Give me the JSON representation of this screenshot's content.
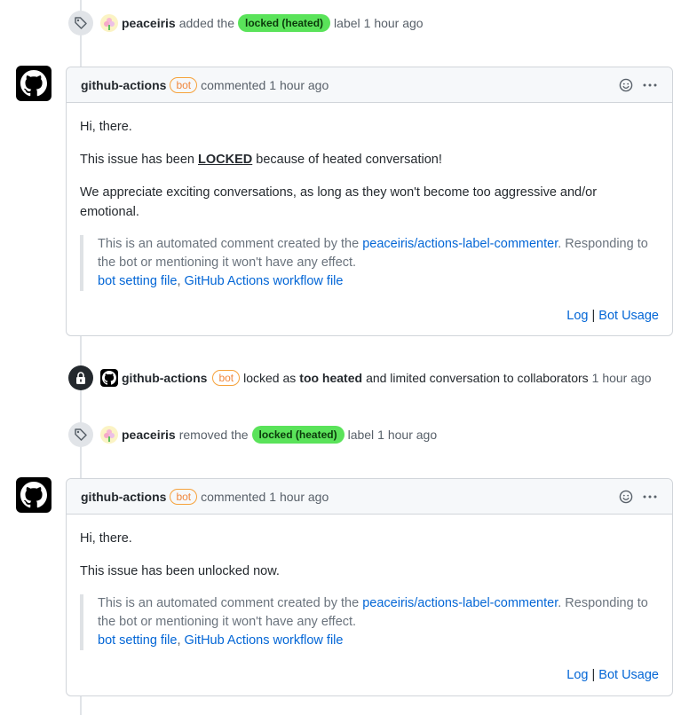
{
  "events": [
    {
      "actor": "peaceiris",
      "action": "added the",
      "label": "locked (heated)",
      "suffix": "label",
      "time": "1 hour ago"
    },
    {
      "actor": "github-actions",
      "bot": "bot",
      "action": "locked as",
      "reason": "too heated",
      "suffix": "and limited conversation to collaborators",
      "time": "1 hour ago"
    },
    {
      "actor": "peaceiris",
      "action": "removed the",
      "label": "locked (heated)",
      "suffix": "label",
      "time": "1 hour ago"
    }
  ],
  "comments": [
    {
      "author": "github-actions",
      "bot": "bot",
      "action": "commented",
      "time": "1 hour ago",
      "greeting": "Hi, there.",
      "line1_pre": "This issue has been",
      "line1_locked": "LOCKED",
      "line1_post": "because of heated conversation!",
      "line2": "We appreciate exciting conversations, as long as they won't become too aggressive and/or emotional.",
      "quote_pre": "This is an automated comment created by the",
      "quote_link": "peaceiris/actions-label-commenter",
      "quote_post": ". Responding to the bot or mentioning it won't have any effect.",
      "link_bot_setting": "bot setting file",
      "link_workflow": "GitHub Actions workflow file",
      "log": "Log",
      "sep": "|",
      "usage": "Bot Usage"
    },
    {
      "author": "github-actions",
      "bot": "bot",
      "action": "commented",
      "time": "1 hour ago",
      "greeting": "Hi, there.",
      "line1": "This issue has been unlocked now.",
      "quote_pre": "This is an automated comment created by the",
      "quote_link": "peaceiris/actions-label-commenter",
      "quote_post": ". Responding to the bot or mentioning it won't have any effect.",
      "link_bot_setting": "bot setting file",
      "link_workflow": "GitHub Actions workflow file",
      "log": "Log",
      "sep": "|",
      "usage": "Bot Usage"
    }
  ],
  "icons": {
    "tag": "tag-icon",
    "lock": "lock-icon",
    "smiley": "smiley-icon",
    "kebab": "kebab-menu-icon",
    "github": "github-mark-icon"
  },
  "colors": {
    "label_bg": "#5ae35a",
    "bot_border": "#f6a23b",
    "link": "#0366d6"
  }
}
